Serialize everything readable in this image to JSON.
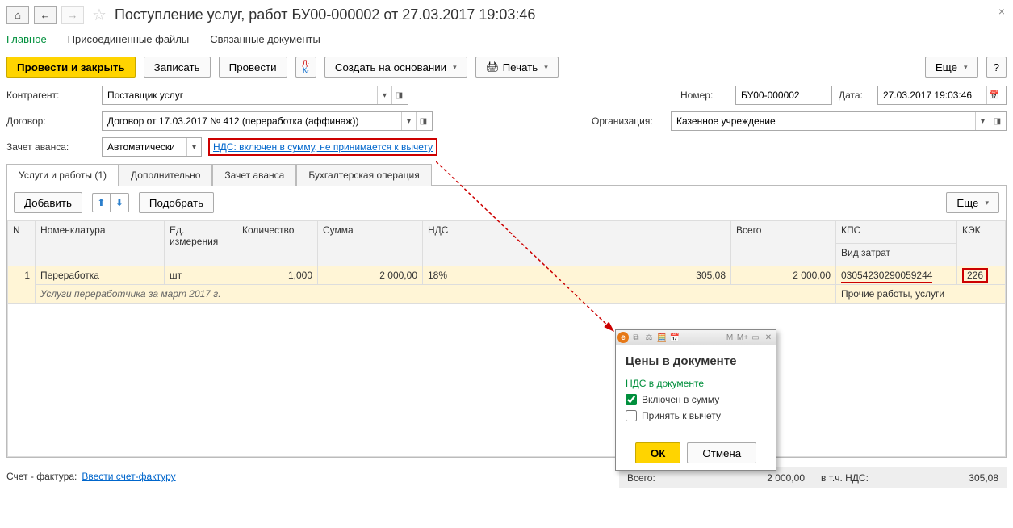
{
  "header": {
    "title": "Поступление услуг, работ БУ00-000002 от 27.03.2017 19:03:46"
  },
  "breadcrumbs": {
    "main": "Главное",
    "files": "Присоединенные файлы",
    "related": "Связанные документы"
  },
  "toolbar": {
    "post_close": "Провести и закрыть",
    "write": "Записать",
    "post": "Провести",
    "create_based": "Создать на основании",
    "print": "Печать",
    "more": "Еще"
  },
  "form": {
    "contragent_label": "Контрагент:",
    "contragent_value": "Поставщик услуг",
    "number_label": "Номер:",
    "number_value": "БУ00-000002",
    "date_label": "Дата:",
    "date_value": "27.03.2017 19:03:46",
    "contract_label": "Договор:",
    "contract_value": "Договор от 17.03.2017 № 412 (переработка (аффинаж))",
    "org_label": "Организация:",
    "org_value": "Казенное учреждение",
    "advance_label": "Зачет аванса:",
    "advance_value": "Автоматически",
    "nds_link": "НДС: включен в сумму, не принимается к вычету"
  },
  "doc_tabs": {
    "services": "Услуги и работы (1)",
    "additional": "Дополнительно",
    "advance": "Зачет аванса",
    "accounting": "Бухгалтерская операция"
  },
  "grid_tools": {
    "add": "Добавить",
    "pick": "Подобрать",
    "more": "Еще"
  },
  "grid": {
    "headers": {
      "n": "N",
      "nomenclature": "Номенклатура",
      "unit": "Ед. измерения",
      "qty": "Количество",
      "sum": "Сумма",
      "nds": "НДС",
      "nds_amount": "",
      "total": "Всего",
      "kps": "КПС",
      "kek": "КЭК",
      "cost_type": "Вид затрат"
    },
    "row": {
      "n": "1",
      "nomenclature": "Переработка",
      "unit": "шт",
      "qty": "1,000",
      "sum": "2 000,00",
      "nds": "18%",
      "nds_amount": "305,08",
      "total": "2 000,00",
      "kps": "03054230290059244",
      "kek": "226",
      "sub": "Услуги переработчика за март 2017 г.",
      "cost_type": "Прочие работы, услуги"
    }
  },
  "footer": {
    "invoice_label": "Счет - фактура:",
    "invoice_link": "Ввести счет-фактуру",
    "total_label": "Всего:",
    "total_value": "2 000,00",
    "nds_label": "в т.ч. НДС:",
    "nds_value": "305,08"
  },
  "popup": {
    "title": "Цены в документе",
    "section": "НДС в документе",
    "cb1": "Включен в сумму",
    "cb2": "Принять к вычету",
    "ok": "ОК",
    "cancel": "Отмена"
  }
}
